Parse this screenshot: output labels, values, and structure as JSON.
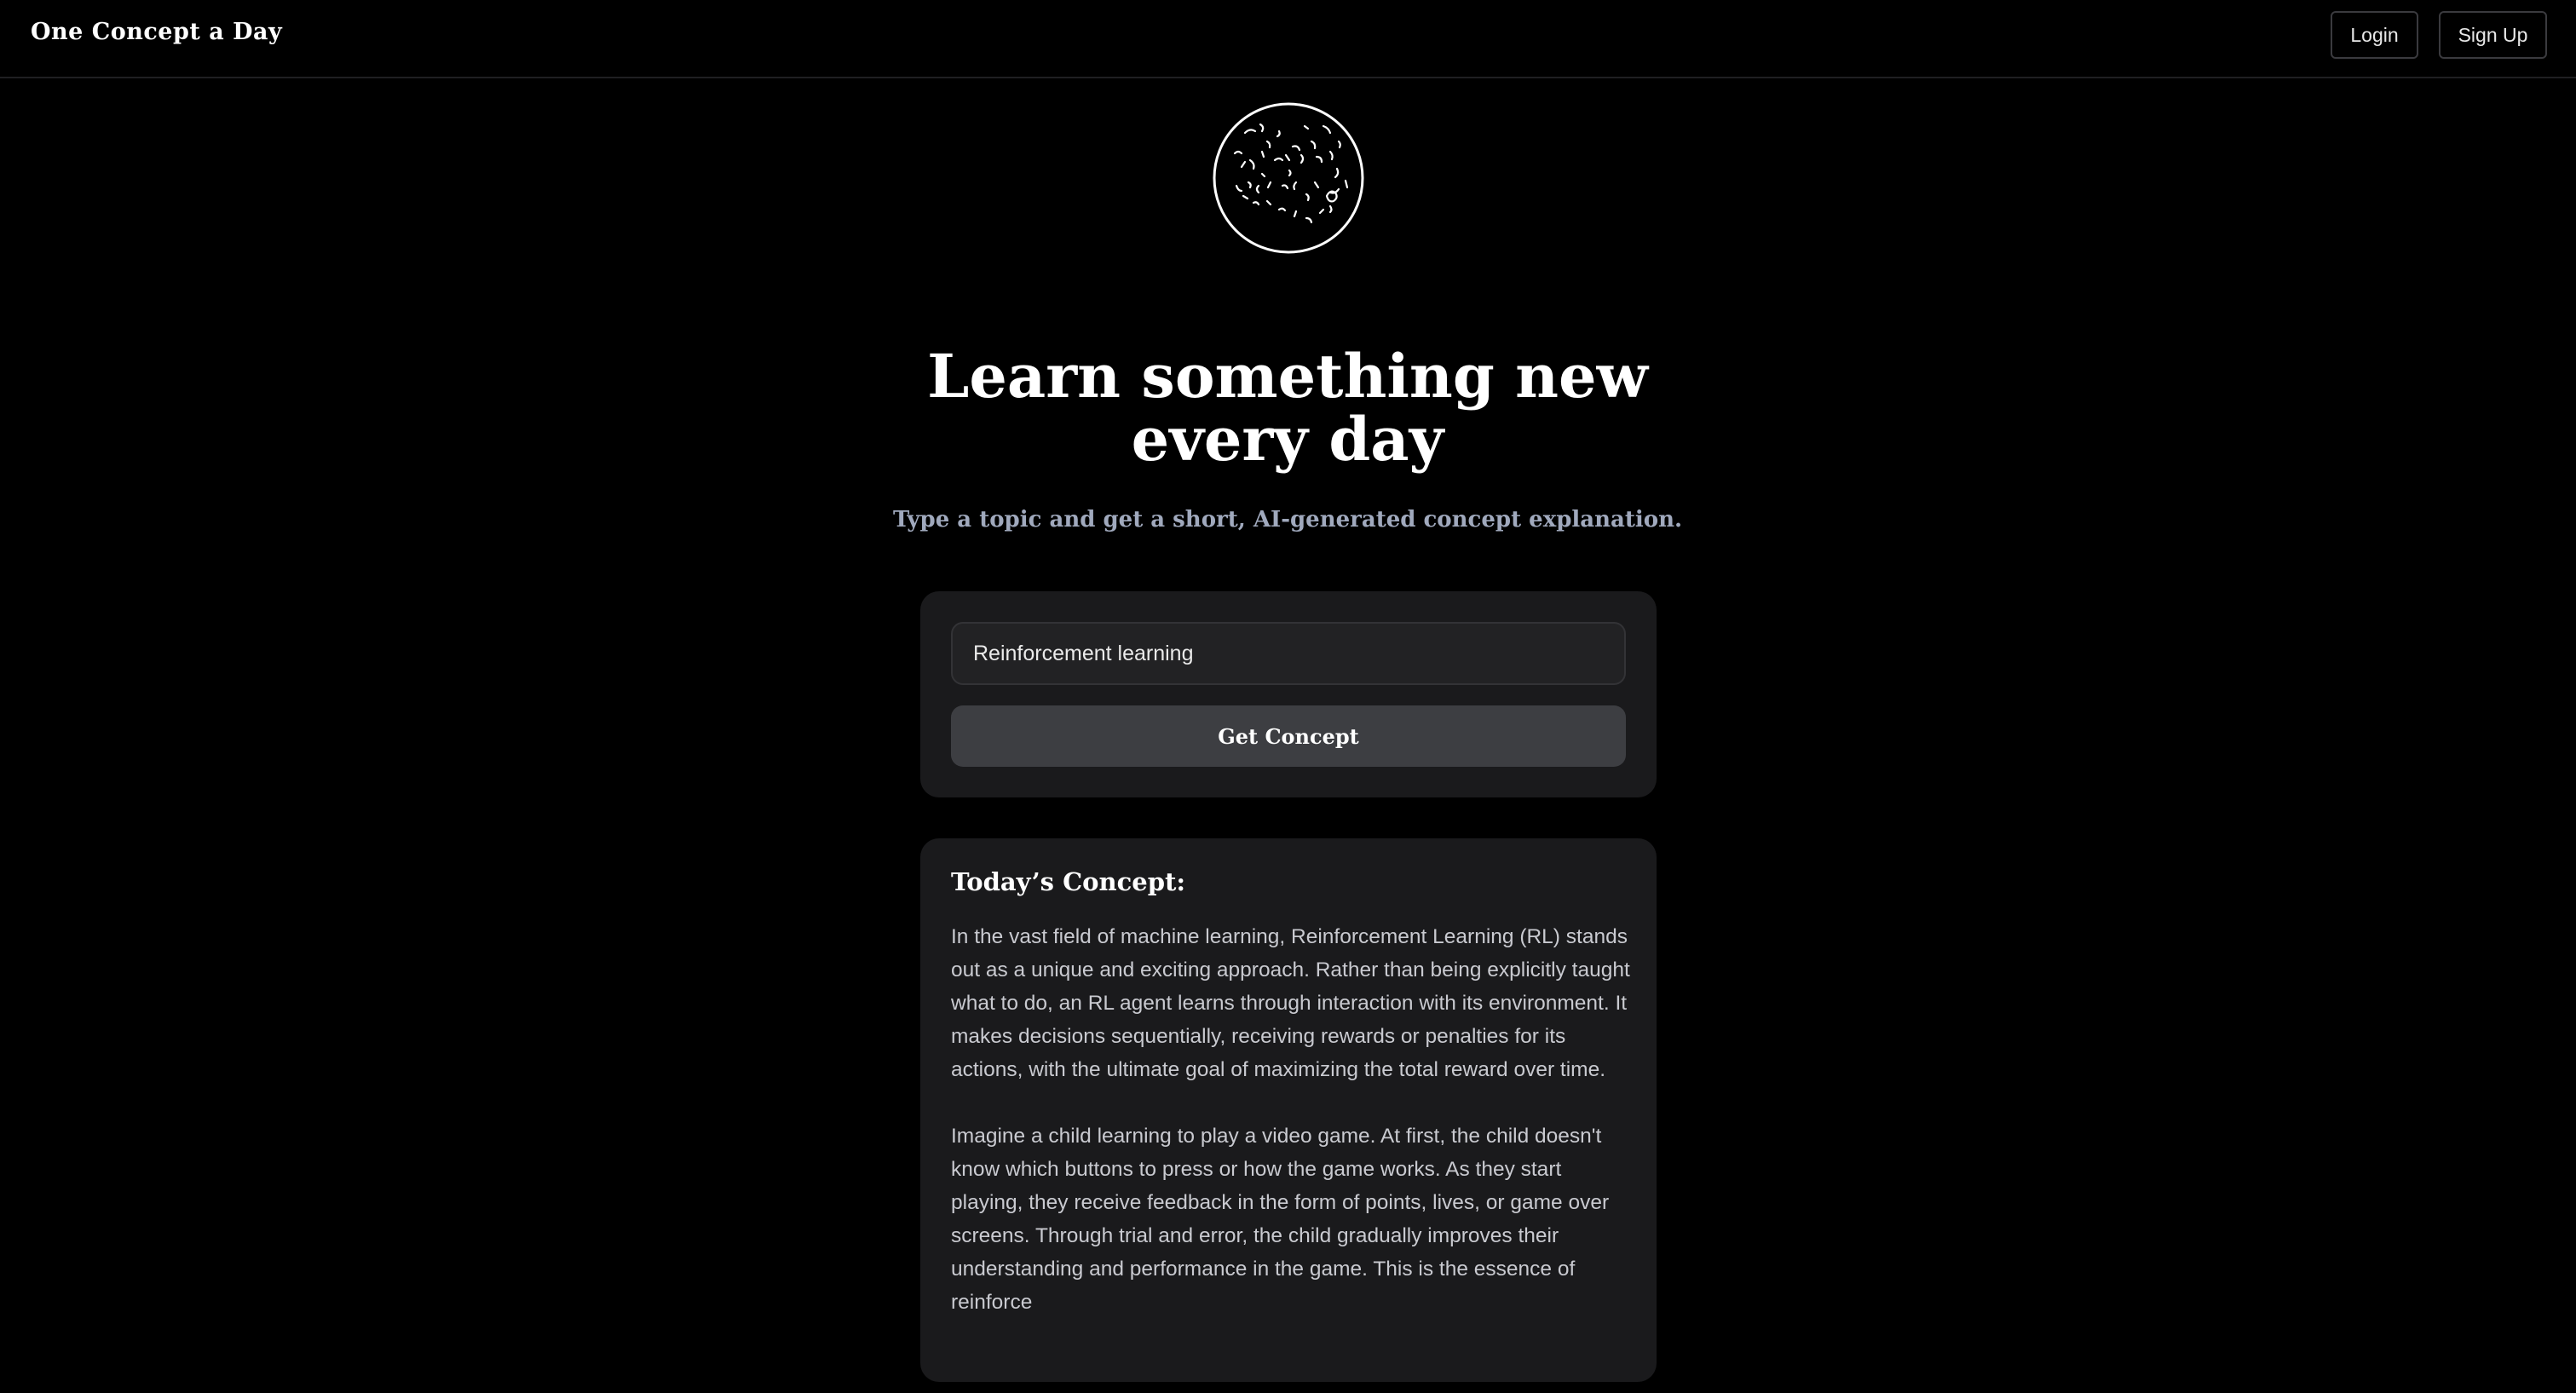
{
  "header": {
    "brand": "One Concept a Day",
    "login_label": "Login",
    "signup_label": "Sign Up"
  },
  "hero": {
    "logo_icon": "moon-icon",
    "headline_line1": "Learn something new",
    "headline_line2": "every day",
    "subheadline": "Type a topic and get a short, AI-generated concept explanation."
  },
  "form": {
    "topic_value": "Reinforcement learning",
    "submit_label": "Get Concept"
  },
  "concept": {
    "title": "Today’s Concept:",
    "paragraphs": [
      "In the vast field of machine learning, Reinforcement Learning (RL) stands out as a unique and exciting approach. Rather than being explicitly taught what to do, an RL agent learns through interaction with its environment. It makes decisions sequentially, receiving rewards or penalties for its actions, with the ultimate goal of maximizing the total reward over time.",
      "Imagine a child learning to play a video game. At first, the child doesn't know which buttons to press or how the game works. As they start playing, they receive feedback in the form of points, lives, or game over screens. Through trial and error, the child gradually improves their understanding and performance in the game. This is the essence of reinforce"
    ]
  },
  "colors": {
    "background": "#000000",
    "card": "#1a1a1c",
    "button": "#3d3e42",
    "subheadline": "#a0a9bd"
  }
}
